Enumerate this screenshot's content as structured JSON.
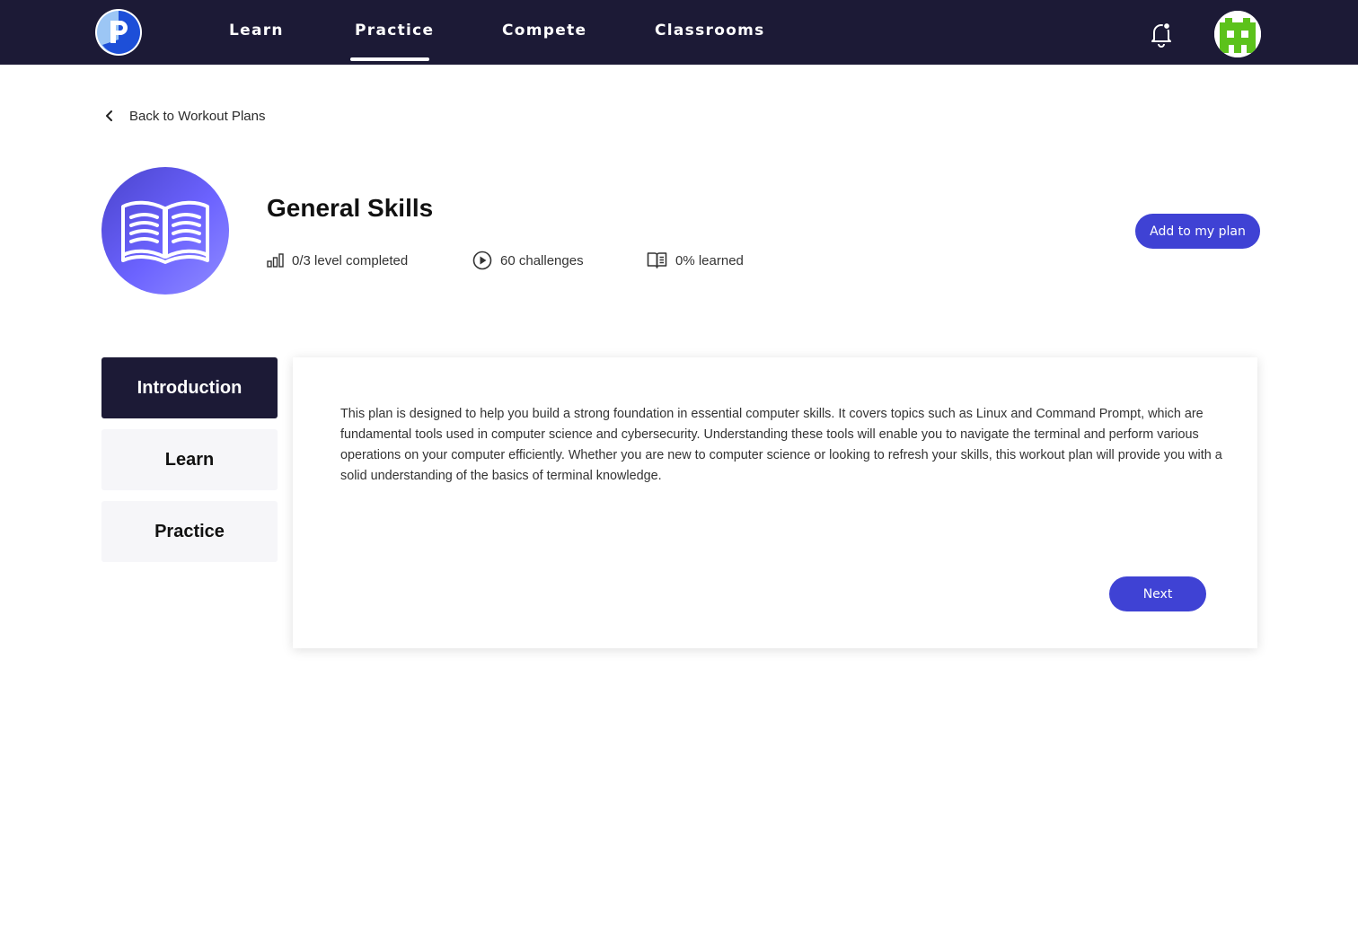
{
  "nav": {
    "items": [
      {
        "label": "Learn"
      },
      {
        "label": "Practice"
      },
      {
        "label": "Compete"
      },
      {
        "label": "Classrooms"
      }
    ],
    "active": "Practice"
  },
  "back": {
    "label": "Back to Workout Plans"
  },
  "plan": {
    "title": "General Skills",
    "stats": {
      "levels": "0/3 level completed",
      "challenges": "60 challenges",
      "learned": "0% learned"
    },
    "add_button": "Add to my plan"
  },
  "tabs": [
    {
      "label": "Introduction",
      "active": true
    },
    {
      "label": "Learn",
      "active": false
    },
    {
      "label": "Practice",
      "active": false
    }
  ],
  "panel": {
    "text": "This plan is designed to help you build a strong foundation in essential computer skills. It covers topics such as Linux and Command Prompt, which are fundamental tools used in computer science and cybersecurity. Understanding these tools will enable you to navigate the terminal and perform various operations on your computer efficiently. Whether you are new to computer science or looking to refresh your skills, this workout plan will provide you with a solid understanding of the basics of terminal knowledge.",
    "next_button": "Next"
  },
  "icons": {
    "logo": "picoctf-logo-icon",
    "bell": "bell-icon",
    "avatar": "avatar-icon",
    "back": "chevron-left-icon",
    "hero": "open-book-icon",
    "levels": "bar-chart-icon",
    "challenges": "play-circle-icon",
    "learned": "book-icon"
  },
  "colors": {
    "topbar": "#1c1a36",
    "accent": "#3f42d4",
    "avatar_green": "#5cc21b",
    "hero_gradient_start": "#4a44cc",
    "hero_gradient_end": "#8f8bff"
  }
}
